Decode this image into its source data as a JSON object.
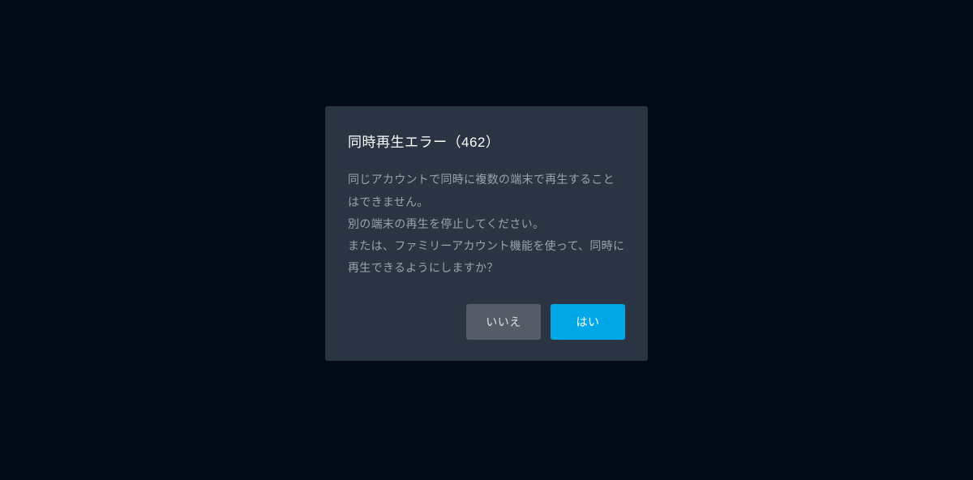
{
  "dialog": {
    "title": "同時再生エラー（462）",
    "message": "同じアカウントで同時に複数の端末で再生することはできません。\n別の端末の再生を停止してください。\nまたは、ファミリーアカウント機能を使って、同時に再生できるようにしますか？",
    "buttons": {
      "no": "いいえ",
      "yes": "はい"
    }
  }
}
